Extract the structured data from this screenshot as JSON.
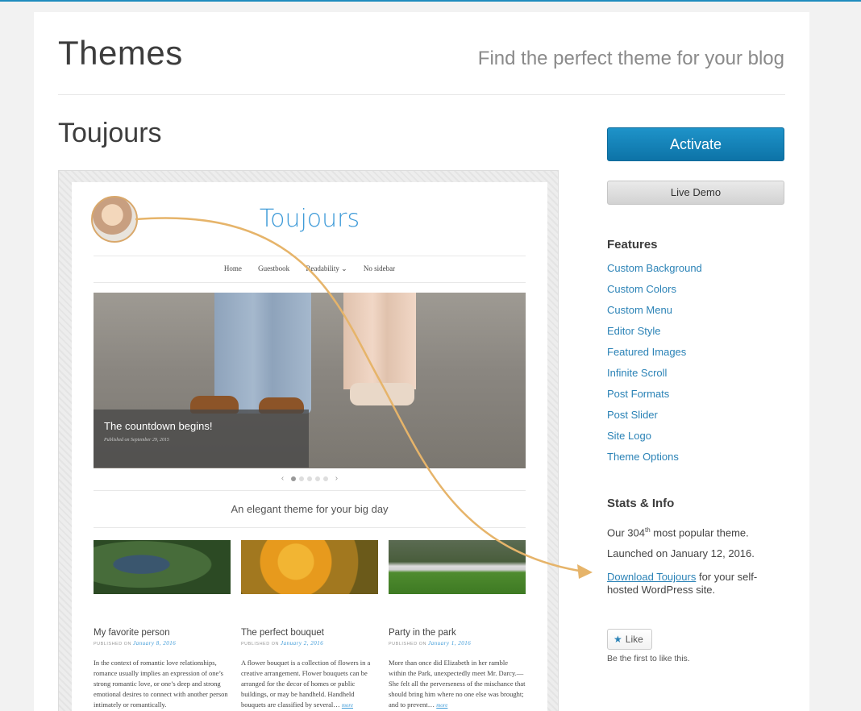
{
  "header": {
    "title": "Themes",
    "tagline": "Find the perfect theme for your blog"
  },
  "theme": {
    "name": "Toujours"
  },
  "preview": {
    "site_title": "Toujours",
    "menu": [
      "Home",
      "Guestbook",
      "Readability ⌄",
      "No sidebar"
    ],
    "slide": {
      "title": "The countdown begins!",
      "date": "Published on September 29, 2015"
    },
    "slider_prev": "‹",
    "slider_next": "›",
    "tagline": "An elegant theme for your big day",
    "posts": [
      {
        "title": "My favorite person",
        "meta": "PUBLISHED ON",
        "date": "January 8, 2016",
        "excerpt": "In the context of romantic love relationships, romance usually implies an expression of one’s strong romantic love, or one’s deep and strong emotional desires to connect with another person intimately or romantically.",
        "more": ""
      },
      {
        "title": "The perfect bouquet",
        "meta": "PUBLISHED ON",
        "date": "January 2, 2016",
        "excerpt": "A flower bouquet is a collection of flowers in a creative arrangement. Flower bouquets can be arranged for the decor of homes or public buildings, or may be handheld. Handheld bouquets are classified by several…",
        "more": "more"
      },
      {
        "title": "Party in the park",
        "meta": "PUBLISHED ON",
        "date": "January 1, 2016",
        "excerpt": "More than once did Elizabeth in her ramble within the Park, unexpectedly meet Mr. Darcy.—She felt all the perverseness of the mischance that should bring him where no one else was brought; and to prevent…",
        "more": "more"
      }
    ]
  },
  "sidebar": {
    "activate_label": "Activate",
    "live_demo_label": "Live Demo",
    "features_heading": "Features",
    "features": [
      "Custom Background",
      "Custom Colors",
      "Custom Menu",
      "Editor Style",
      "Featured Images",
      "Infinite Scroll",
      "Post Formats",
      "Post Slider",
      "Site Logo",
      "Theme Options"
    ],
    "stats_heading": "Stats & Info",
    "popularity_prefix": "Our 304",
    "popularity_sup": "th",
    "popularity_suffix": " most popular theme.",
    "launched": "Launched on January 12, 2016.",
    "download_link": "Download Toujours",
    "download_suffix": " for your self-hosted WordPress site.",
    "like_label": "Like",
    "like_note": "Be the first to like this."
  },
  "colors": {
    "accent": "#1e8cbe",
    "link": "#2a82b6",
    "annotation": "#e6b46a"
  }
}
